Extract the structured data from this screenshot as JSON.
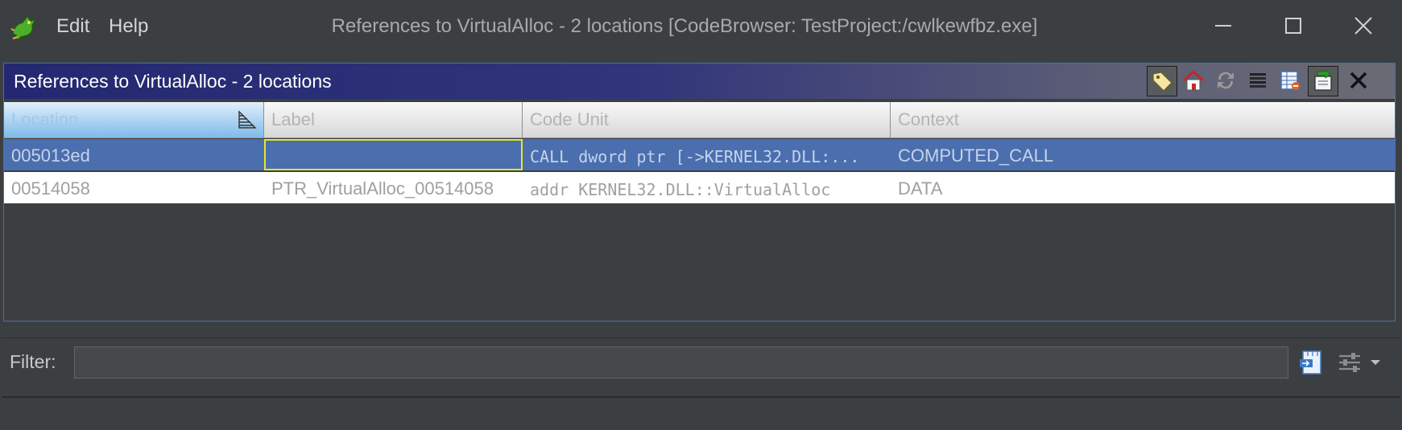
{
  "menu": {
    "edit": "Edit",
    "help": "Help"
  },
  "window": {
    "title": "References to VirtualAlloc - 2 locations [CodeBrowser: TestProject:/cwlkewfbz.exe]"
  },
  "panel": {
    "title": "References to VirtualAlloc - 2 locations"
  },
  "table": {
    "columns": [
      "Location",
      "Label",
      "Code Unit",
      "Context"
    ],
    "rows": [
      {
        "location": "005013ed",
        "label": "",
        "code_unit": "CALL dword ptr [->KERNEL32.DLL:...",
        "context": "COMPUTED_CALL"
      },
      {
        "location": "00514058",
        "label": "PTR_VirtualAlloc_00514058",
        "code_unit": "addr KERNEL32.DLL::VirtualAlloc",
        "context": "DATA"
      }
    ]
  },
  "filter": {
    "label": "Filter:",
    "value": ""
  },
  "colors": {
    "selection": "#4b6eaf",
    "header_gradient_start": "#232871",
    "focus_border": "#e6e62a",
    "window_bg": "#3c3f41"
  },
  "icons": {
    "toolbar": [
      "tag-icon",
      "home-icon",
      "refresh-icon",
      "list-icon",
      "table-delete-icon",
      "make-selection-icon",
      "close-icon"
    ],
    "filter": [
      "filter-options-icon",
      "settings-sliders-icon",
      "chevron-down-icon"
    ]
  }
}
